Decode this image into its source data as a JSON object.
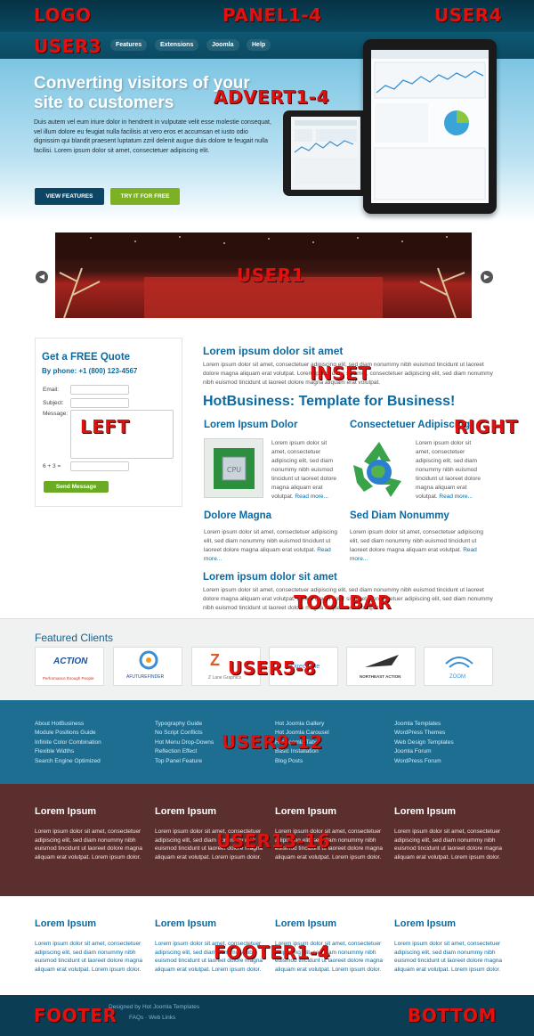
{
  "positions": {
    "logo": "LOGO",
    "panel": "PANEL1-4",
    "user4": "USER4",
    "user3": "USER3",
    "advert": "ADVERT1-4",
    "user1": "USER1",
    "inset": "INSET",
    "left": "LEFT",
    "right": "RIGHT",
    "toolbar": "TOOLBAR",
    "user5_8": "USER5-8",
    "user9_12": "USER9-12",
    "user13_16": "USER13-16",
    "footer1_4": "FOOTER1-4",
    "footer": "FOOTER",
    "bottom": "BOTTOM"
  },
  "menu": [
    "Features",
    "Extensions",
    "Joomla",
    "Help"
  ],
  "hero": {
    "title": "Converting visitors of your site to customers",
    "text": "Duis autem vel eum iriure dolor in hendrerit in vulputate velit esse molestie consequat, vel illum dolore eu feugiat nulla facilisis at vero eros et accumsan et iusto odio dignissim qui blandit praesent luptatum zzril delenit augue duis dolore te feugait nulla facilisi. Lorem ipsum dolor sit amet, consectetuer adipiscing elit.",
    "btn_features": "VIEW FEATURES",
    "btn_try": "TRY IT FOR FREE"
  },
  "quote": {
    "title": "Get a FREE Quote",
    "phone": "By phone: +1 (800) 123-4567",
    "email": "Email:",
    "subject": "Subject:",
    "message": "Message:",
    "captcha": "6 + 3 =",
    "send": "Send Message"
  },
  "main": {
    "intro_title": "Lorem ipsum dolor sit amet",
    "intro_text": "Lorem ipsum dolor sit amet, consectetuer adipiscing elit, sed diam nonummy nibh euismod tincidunt ut laoreet dolore magna aliquam erat volutpat. Lorem ipsum dolor sit amet, consectetuer adipiscing elit, sed diam nonummy nibh euismod tincidunt ut laoreet dolore magna aliquam erat volutpat.",
    "headline": "HotBusiness: Template for Business!",
    "f1_title": "Lorem Ipsum Dolor",
    "f1_text": "Lorem ipsum dolor sit amet, consectetuer adipiscing elit, sed diam nonummy nibh euismod tincidunt ut laoreet dolore magna aliquam erat volutpat.",
    "f2_title": "Consectetuer Adipiscing",
    "f2_text": "Lorem ipsum dolor sit amet, consectetuer adipiscing elit, sed diam nonummy nibh euismod tincidunt ut laoreet dolore magna aliquam erat volutpat.",
    "read_more": "Read more...",
    "f3_title": "Dolore Magna",
    "f3_text": "Lorem ipsum dolor sit amet, consectetuer adipiscing elit, sed diam nonummy nibh euismod tincidunt ut laoreet dolore magna aliquam erat volutpat.",
    "f4_title": "Sed Diam Nonummy",
    "f4_text": "Lorem ipsum dolor sit amet, consectetuer adipiscing elit, sed diam nonummy nibh euismod tincidunt ut laoreet dolore magna aliquam erat volutpat.",
    "bottom_title": "Lorem ipsum dolor sit amet",
    "bottom_text": "Lorem ipsum dolor sit amet, consectetuer adipiscing elit, sed diam nonummy nibh euismod tincidunt ut laoreet dolore magna aliquam erat volutpat. Lorem ipsum dolor sit amet, consectetuer adipiscing elit, sed diam nonummy nibh euismod tincidunt ut laoreet dolore magna aliquam erat volutpat."
  },
  "clients": {
    "title": "Featured Clients",
    "logos": [
      "ACTION",
      "Performance through People",
      "AFUTUREFINDER",
      "Z Lane Graphics",
      "Direct Site",
      "NORTHEAST ACTION",
      "ZOOM"
    ]
  },
  "links": {
    "col1": [
      "About HotBusiness",
      "Module Positions Guide",
      "Infinite Color Combination",
      "Flexible Widths",
      "Search Engine Optimized"
    ],
    "col2": [
      "Typography Guide",
      "No Script Conflicts",
      "Hot Menu Drop-Downs",
      "Reflection Effect",
      "Top Panel Feature"
    ],
    "col3": [
      "Hot Joomla Gallery",
      "Hot Joomla Carousel",
      "Hot Joomla Tabs",
      "Basic Installation",
      "Blog Posts"
    ],
    "col4": [
      "Joomla Templates",
      "WordPress Themes",
      "Web Design Templates",
      "Joomla Forum",
      "WordPress Forum"
    ]
  },
  "brown": {
    "title": "Lorem Ipsum",
    "text": "Lorem ipsum dolor sit amet, consectetuer adipiscing elit, sed diam nonummy nibh euismod tincidunt ut laoreet dolore magna aliquam erat volutpat. Lorem ipsum dolor."
  },
  "footer": {
    "title": "Lorem Ipsum",
    "text": "Lorem ipsum dolor sit amet, consectetuer adipiscing elit, sed diam nonummy nibh euismod tincidunt ut laoreet dolore magna aliquam erat volutpat. Lorem ipsum dolor."
  },
  "bottom": {
    "credit": "Designed by Hot Joomla Templates",
    "links": "FAQs · Web Links"
  }
}
